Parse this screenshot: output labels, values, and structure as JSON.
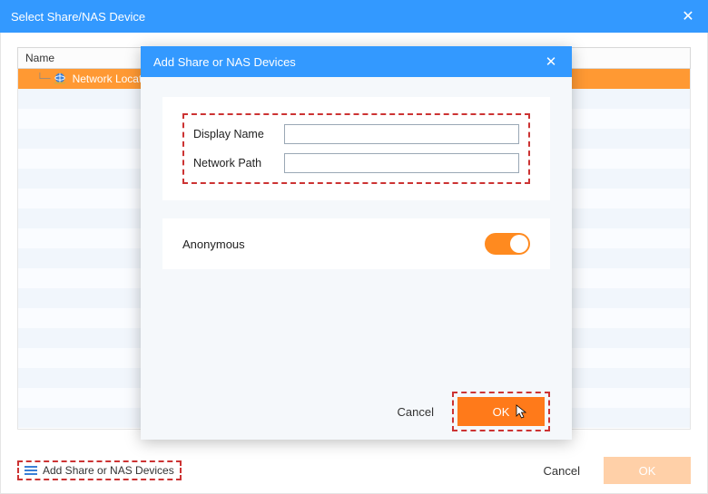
{
  "parent": {
    "title": "Select Share/NAS Device",
    "grid": {
      "header": "Name",
      "rows": [
        {
          "label": "Network Location",
          "selected": true
        }
      ]
    },
    "footer": {
      "addLink": "Add Share or NAS Devices",
      "cancel": "Cancel",
      "ok": "OK"
    }
  },
  "modal": {
    "title": "Add Share or NAS Devices",
    "fields": {
      "displayName": {
        "label": "Display Name",
        "value": ""
      },
      "networkPath": {
        "label": "Network Path",
        "value": ""
      }
    },
    "anonymous": {
      "label": "Anonymous",
      "on": true
    },
    "footer": {
      "cancel": "Cancel",
      "ok": "OK"
    }
  },
  "colors": {
    "primary": "#3399ff",
    "accent": "#ff7a1a",
    "highlightDash": "#cc3333"
  }
}
